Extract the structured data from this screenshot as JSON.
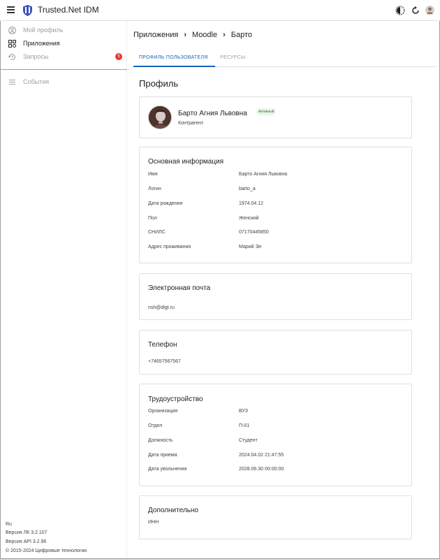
{
  "app": {
    "title": "Trusted.Net IDM"
  },
  "icons": {
    "menu": "menu-icon",
    "logo": "shield-logo",
    "theme": "theme-toggle-icon",
    "refresh": "refresh-icon",
    "user_avatar": "user-avatar"
  },
  "sidebar": {
    "items": [
      {
        "label": "Мой профиль",
        "icon": "account-circle-icon",
        "active": false
      },
      {
        "label": "Приложения",
        "icon": "apps-grid-icon",
        "active": true
      },
      {
        "label": "Запросы",
        "icon": "history-icon",
        "active": false,
        "badge": "5"
      },
      {
        "label": "События",
        "icon": "list-icon",
        "active": false
      }
    ],
    "footer": {
      "lang": "Ru",
      "lk_version": "Версия ЛК 3.2.107",
      "api_version": "Версия API 3.2.96",
      "copyright": "© 2015-2024 Цифровые технологии"
    }
  },
  "breadcrumb": [
    "Приложения",
    "Moodle",
    "Барто"
  ],
  "tabs": [
    {
      "label": "ПРОФИЛЬ ПОЛЬЗОВАТЕЛЯ",
      "active": true
    },
    {
      "label": "РЕСУРСЫ",
      "active": false
    }
  ],
  "page_title": "Профиль",
  "profile": {
    "name": "Барто Агния Львовна",
    "status": "Активный",
    "role": "Контрагент"
  },
  "basic_info": {
    "title": "Основная информация",
    "rows": [
      {
        "label": "Имя",
        "value": "Барто Агния Львовна"
      },
      {
        "label": "Логин",
        "value": "barto_a"
      },
      {
        "label": "Дата рождения",
        "value": "1974.04.12"
      },
      {
        "label": "Пол",
        "value": "Женский"
      },
      {
        "label": "СНИЛС",
        "value": "07170445850"
      },
      {
        "label": "Адрес проживания",
        "value": "Марий Эл"
      }
    ]
  },
  "email": {
    "title": "Электронная почта",
    "value": "nsh@digt.ru"
  },
  "phone": {
    "title": "Телефон",
    "value": "+74657567567"
  },
  "employment": {
    "title": "Трудоустройство",
    "rows": [
      {
        "label": "Организация",
        "value": "ВУЗ"
      },
      {
        "label": "Отдел",
        "value": "П-01"
      },
      {
        "label": "Должность",
        "value": "Студент"
      },
      {
        "label": "Дата приема",
        "value": "2024.04.02 21:47:55"
      },
      {
        "label": "Дата увольнения",
        "value": "2028.06.30 00:00:00"
      }
    ]
  },
  "additional": {
    "title": "Дополнительно",
    "inn_label": "ИНН"
  },
  "colors": {
    "accent": "#1565c0",
    "badge": "#e53935",
    "status_bg": "#e8f5e9",
    "status_fg": "#2e7d32"
  }
}
